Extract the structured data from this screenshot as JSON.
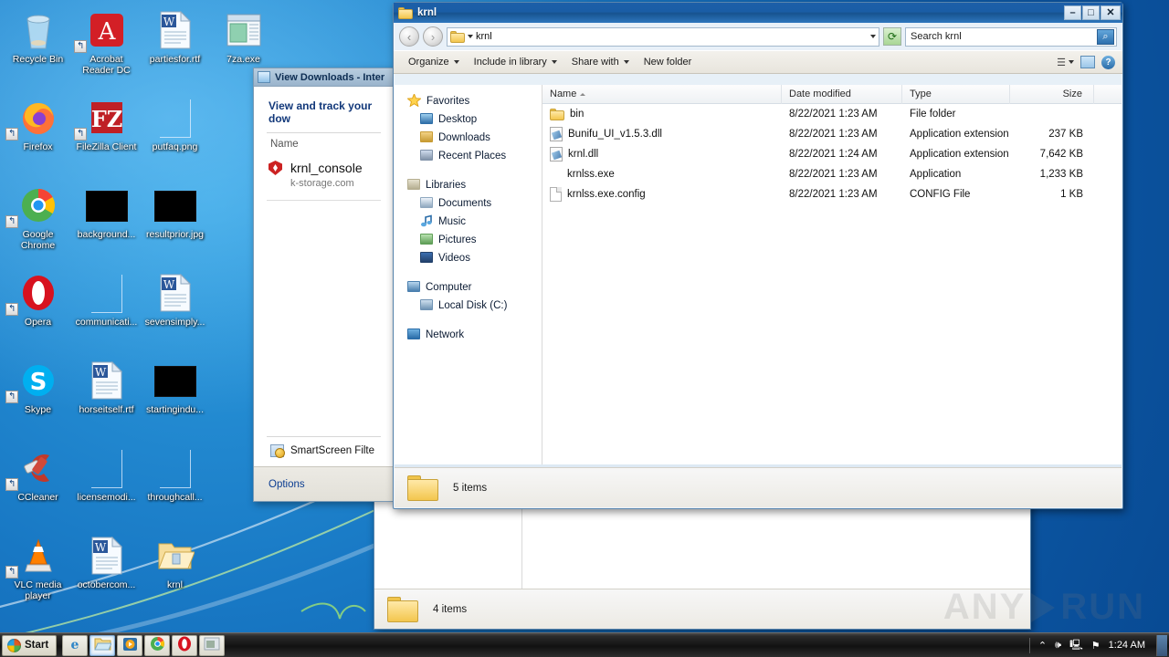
{
  "desktop": {
    "icons": [
      {
        "label": "Recycle Bin",
        "icon": "recycle-bin-icon",
        "shortcut": false
      },
      {
        "label": "Acrobat Reader DC",
        "icon": "acrobat-reader-icon",
        "shortcut": true
      },
      {
        "label": "partiesfor.rtf",
        "icon": "word-document-icon",
        "shortcut": false
      },
      {
        "label": "7za.exe",
        "icon": "application-window-icon",
        "shortcut": false
      },
      {
        "label": "Firefox",
        "icon": "firefox-icon",
        "shortcut": true
      },
      {
        "label": "FileZilla Client",
        "icon": "filezilla-icon",
        "shortcut": true
      },
      {
        "label": "putfaq.png",
        "icon": "blank-image-icon",
        "shortcut": false
      },
      {
        "label": "",
        "icon": "empty-icon",
        "shortcut": false
      },
      {
        "label": "Google Chrome",
        "icon": "chrome-icon",
        "shortcut": true
      },
      {
        "label": "background...",
        "icon": "black-thumbnail-icon",
        "shortcut": false
      },
      {
        "label": "resultprior.jpg",
        "icon": "black-thumbnail-icon",
        "shortcut": false
      },
      {
        "label": "",
        "icon": "empty-icon",
        "shortcut": false
      },
      {
        "label": "Opera",
        "icon": "opera-icon",
        "shortcut": true
      },
      {
        "label": "communicati...",
        "icon": "blank-image-icon",
        "shortcut": false
      },
      {
        "label": "sevensimply...",
        "icon": "word-document-icon",
        "shortcut": false
      },
      {
        "label": "",
        "icon": "empty-icon",
        "shortcut": false
      },
      {
        "label": "Skype",
        "icon": "skype-icon",
        "shortcut": true
      },
      {
        "label": "horseitself.rtf",
        "icon": "word-document-icon",
        "shortcut": false
      },
      {
        "label": "startingindu...",
        "icon": "black-thumbnail-icon",
        "shortcut": false
      },
      {
        "label": "",
        "icon": "empty-icon",
        "shortcut": false
      },
      {
        "label": "CCleaner",
        "icon": "ccleaner-icon",
        "shortcut": true
      },
      {
        "label": "licensemodi...",
        "icon": "blank-image-icon",
        "shortcut": false
      },
      {
        "label": "throughcall...",
        "icon": "blank-image-icon",
        "shortcut": false
      },
      {
        "label": "",
        "icon": "empty-icon",
        "shortcut": false
      },
      {
        "label": "VLC media player",
        "icon": "vlc-icon",
        "shortcut": true
      },
      {
        "label": "octobercom...",
        "icon": "word-document-icon",
        "shortcut": false
      },
      {
        "label": "krnl",
        "icon": "open-folder-icon",
        "shortcut": false
      },
      {
        "label": "",
        "icon": "empty-icon",
        "shortcut": false
      }
    ]
  },
  "ie_downloads": {
    "title": "View Downloads - Inter",
    "heading": "View and track your dow",
    "column_name": "Name",
    "item": {
      "name": "krnl_console",
      "source": "k-storage.com"
    },
    "smartscreen_label": "SmartScreen Filte",
    "options_label": "Options"
  },
  "explorer_back": {
    "status_text": "4 items"
  },
  "explorer": {
    "title": "krnl",
    "window_buttons": {
      "minimize": "–",
      "maximize": "□",
      "close": "✕"
    },
    "address": {
      "path": "krnl"
    },
    "search": {
      "placeholder": "Search krnl",
      "value": "Search krnl"
    },
    "toolbar": {
      "organize": "Organize",
      "include_in_library": "Include in library",
      "share_with": "Share with",
      "new_folder": "New folder"
    },
    "navpane": {
      "groups": [
        {
          "title": "Favorites",
          "icon": "star-icon",
          "items": [
            {
              "label": "Desktop",
              "icon": "desktop-icon"
            },
            {
              "label": "Downloads",
              "icon": "downloads-icon"
            },
            {
              "label": "Recent Places",
              "icon": "recent-places-icon"
            }
          ]
        },
        {
          "title": "Libraries",
          "icon": "libraries-icon",
          "items": [
            {
              "label": "Documents",
              "icon": "documents-icon"
            },
            {
              "label": "Music",
              "icon": "music-icon"
            },
            {
              "label": "Pictures",
              "icon": "pictures-icon"
            },
            {
              "label": "Videos",
              "icon": "videos-icon"
            }
          ]
        },
        {
          "title": "Computer",
          "icon": "computer-icon",
          "items": [
            {
              "label": "Local Disk (C:)",
              "icon": "local-disk-icon"
            }
          ]
        },
        {
          "title": "Network",
          "icon": "network-icon",
          "items": []
        }
      ]
    },
    "columns": [
      "Name",
      "Date modified",
      "Type",
      "Size"
    ],
    "sorted_column": "Name",
    "files": [
      {
        "name": "bin",
        "date": "8/22/2021 1:23 AM",
        "type": "File folder",
        "size": "",
        "icon": "folder-icon"
      },
      {
        "name": "Bunifu_UI_v1.5.3.dll",
        "date": "8/22/2021 1:23 AM",
        "type": "Application extension",
        "size": "237 KB",
        "icon": "dll-icon"
      },
      {
        "name": "krnl.dll",
        "date": "8/22/2021 1:24 AM",
        "type": "Application extension",
        "size": "7,642 KB",
        "icon": "dll-icon"
      },
      {
        "name": "krnlss.exe",
        "date": "8/22/2021 1:23 AM",
        "type": "Application",
        "size": "1,233 KB",
        "icon": "blank-icon"
      },
      {
        "name": "krnlss.exe.config",
        "date": "8/22/2021 1:23 AM",
        "type": "CONFIG File",
        "size": "1 KB",
        "icon": "file-icon"
      }
    ],
    "status_text": "5 items"
  },
  "taskbar": {
    "start_label": "Start",
    "quick_launch": [
      {
        "name": "internet-explorer-taskbar-button",
        "icon": "internet-explorer-icon",
        "active": false
      },
      {
        "name": "windows-explorer-taskbar-button",
        "icon": "folder-icon",
        "active": true
      },
      {
        "name": "media-player-taskbar-button",
        "icon": "media-player-icon",
        "active": false
      },
      {
        "name": "chrome-taskbar-button",
        "icon": "chrome-icon",
        "active": false
      },
      {
        "name": "opera-taskbar-button",
        "icon": "opera-icon",
        "active": false
      },
      {
        "name": "console-taskbar-button",
        "icon": "console-window-icon",
        "active": false
      }
    ],
    "tray": {
      "show_hidden": "⌃",
      "volume": "volume-icon",
      "network": "network-icon",
      "action_center": "flag-icon",
      "clock": "1:24 AM"
    }
  },
  "watermark": {
    "left": "ANY",
    "right": "RUN"
  }
}
